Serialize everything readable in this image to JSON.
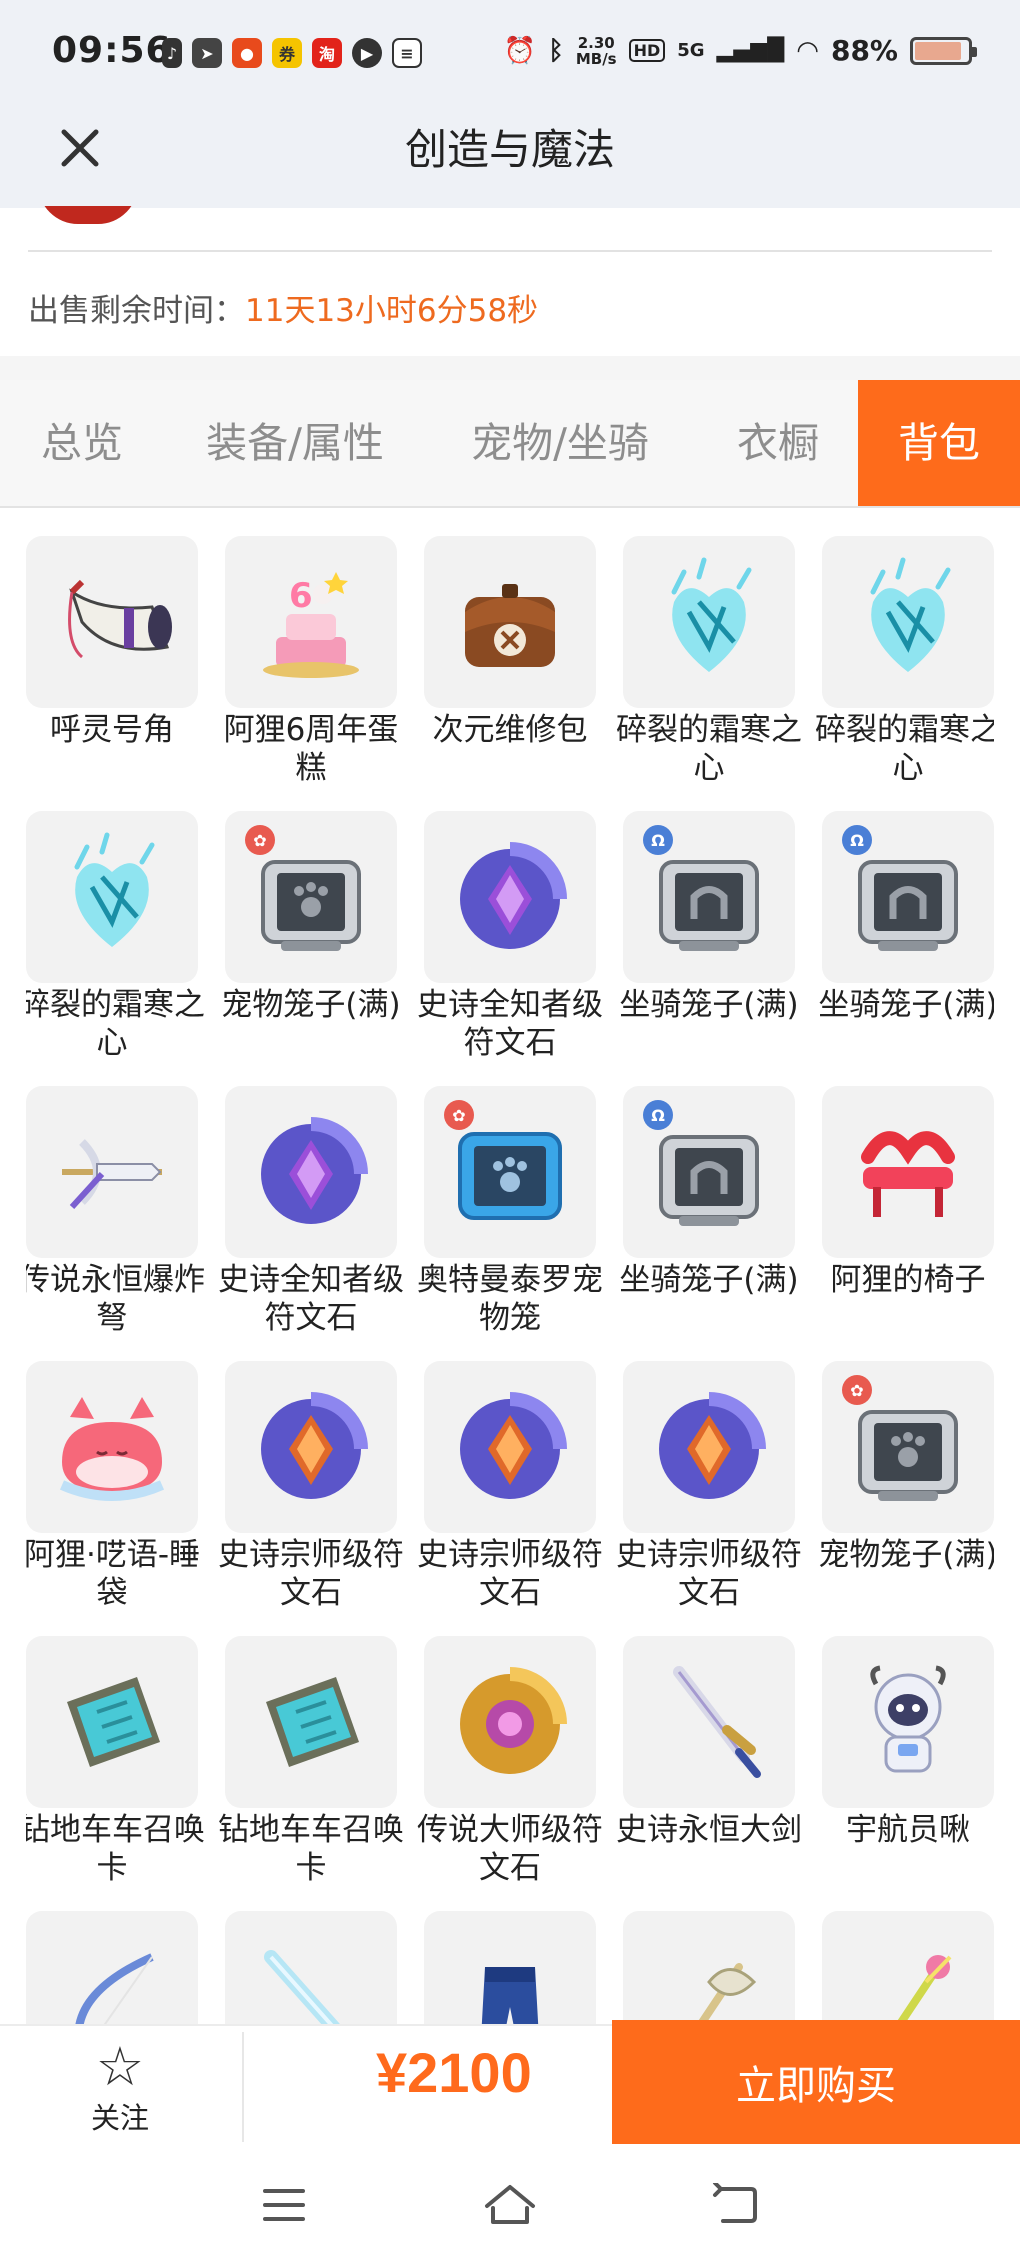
{
  "status_bar": {
    "time": "09:56",
    "net_speed_value": "2.30",
    "net_speed_unit": "MB/s",
    "hd": "HD",
    "network": "5G",
    "battery_pct": "88%",
    "battery_level": 0.88,
    "app_icons": [
      "music-note-icon",
      "telegram-icon",
      "game-app-icon",
      "coupon-app-icon",
      "shopping-app-icon",
      "video-app-icon",
      "notes-app-icon"
    ]
  },
  "header": {
    "title": "创造与魔法"
  },
  "sale": {
    "label": "出售剩余时间：",
    "value": "11天13小时6分58秒"
  },
  "tabs": [
    {
      "label": "总览",
      "active": false
    },
    {
      "label": "装备/属性",
      "active": false
    },
    {
      "label": "宠物/坐骑",
      "active": false
    },
    {
      "label": "衣橱",
      "active": false
    },
    {
      "label": "背包",
      "active": true
    }
  ],
  "items": [
    {
      "name": "呼灵号角",
      "icon": "horn-icon"
    },
    {
      "name": "阿狸6周年蛋糕",
      "icon": "cake-icon"
    },
    {
      "name": "次元维修包",
      "icon": "repair-bag-icon"
    },
    {
      "name": "碎裂的霜寒之心",
      "icon": "frost-heart-icon"
    },
    {
      "name": "碎裂的霜寒之心",
      "icon": "frost-heart-icon"
    },
    {
      "name": "碎裂的霜寒之心",
      "icon": "frost-heart-icon"
    },
    {
      "name": "宠物笼子(满)",
      "icon": "pet-cage-icon"
    },
    {
      "name": "史诗全知者级符文石",
      "icon": "rune-stone-purple-icon"
    },
    {
      "name": "坐骑笼子(满)",
      "icon": "mount-cage-icon"
    },
    {
      "name": "坐骑笼子(满)",
      "icon": "mount-cage-icon"
    },
    {
      "name": "传说永恒爆炸弩",
      "icon": "crossbow-icon"
    },
    {
      "name": "史诗全知者级符文石",
      "icon": "rune-stone-purple-icon"
    },
    {
      "name": "奥特曼泰罗宠物笼",
      "icon": "blue-pet-cage-icon"
    },
    {
      "name": "坐骑笼子(满)",
      "icon": "mount-cage-icon"
    },
    {
      "name": "阿狸的椅子",
      "icon": "chair-icon"
    },
    {
      "name": "阿狸·呓语-睡袋",
      "icon": "sleeping-bag-icon"
    },
    {
      "name": "史诗宗师级符文石",
      "icon": "rune-stone-orange-icon"
    },
    {
      "name": "史诗宗师级符文石",
      "icon": "rune-stone-orange-icon"
    },
    {
      "name": "史诗宗师级符文石",
      "icon": "rune-stone-orange-icon"
    },
    {
      "name": "宠物笼子(满)",
      "icon": "pet-cage-icon"
    },
    {
      "name": "钻地车车召唤卡",
      "icon": "summon-card-icon"
    },
    {
      "name": "钻地车车召唤卡",
      "icon": "summon-card-icon"
    },
    {
      "name": "传说大师级符文石",
      "icon": "rune-stone-gold-icon"
    },
    {
      "name": "史诗永恒大剑",
      "icon": "greatsword-icon"
    },
    {
      "name": "宇航员啾",
      "icon": "astronaut-icon"
    },
    {
      "name": "",
      "icon": "bow-icon"
    },
    {
      "name": "",
      "icon": "ice-blade-icon"
    },
    {
      "name": "",
      "icon": "armor-legs-icon"
    },
    {
      "name": "",
      "icon": "axe-icon"
    },
    {
      "name": "",
      "icon": "staff-icon"
    }
  ],
  "bottom": {
    "follow_label": "关注",
    "price": "¥2100",
    "buy_label": "立即购买"
  },
  "colors": {
    "accent": "#fe6b1b",
    "sale_value": "#ee6a1f",
    "header_bg": "#eef1f6"
  }
}
